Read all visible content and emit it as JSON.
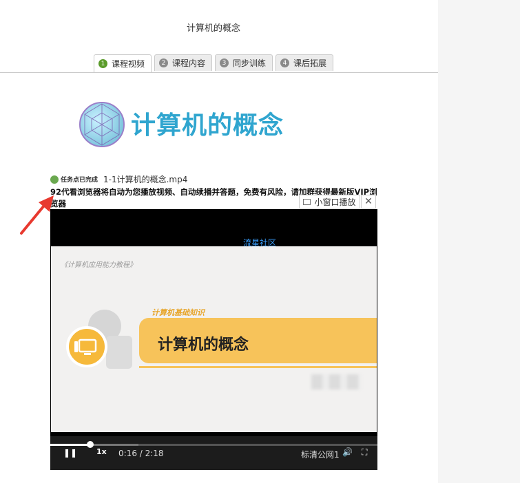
{
  "page_title": "计算机的概念",
  "tabs": [
    {
      "num": "1",
      "label": "课程视频",
      "active": true
    },
    {
      "num": "2",
      "label": "课程内容",
      "active": false
    },
    {
      "num": "3",
      "label": "同步训练",
      "active": false
    },
    {
      "num": "4",
      "label": "课后拓展",
      "active": false
    }
  ],
  "banner": {
    "title": "计算机的概念"
  },
  "task": {
    "status": "任务点已完成",
    "file_name": "1-1计算机的概念.mp4"
  },
  "notice": "92代看浏览器将自动为您播放视频、自动续播并答题，免费有风险，请加群获得最新版VIP浏览器",
  "mini_player_label": "小窗口播放",
  "close_label": "✕",
  "video": {
    "site_name": "流星社区",
    "slide_caption": "《计算机应用能力教程》",
    "slide_subtitle": "计算机基础知识",
    "slide_heading": "计算机的概念",
    "progress_fraction": 0.122,
    "buffer_fraction": 0.27,
    "speed": "1x",
    "time": "0:16 / 2:18",
    "quality": "标清公网1"
  },
  "colors": {
    "accent_green": "#5a9b2a",
    "banner_blue": "#2fa5cf",
    "slide_orange": "#f7c35a",
    "arrow_red": "#e8392f"
  }
}
